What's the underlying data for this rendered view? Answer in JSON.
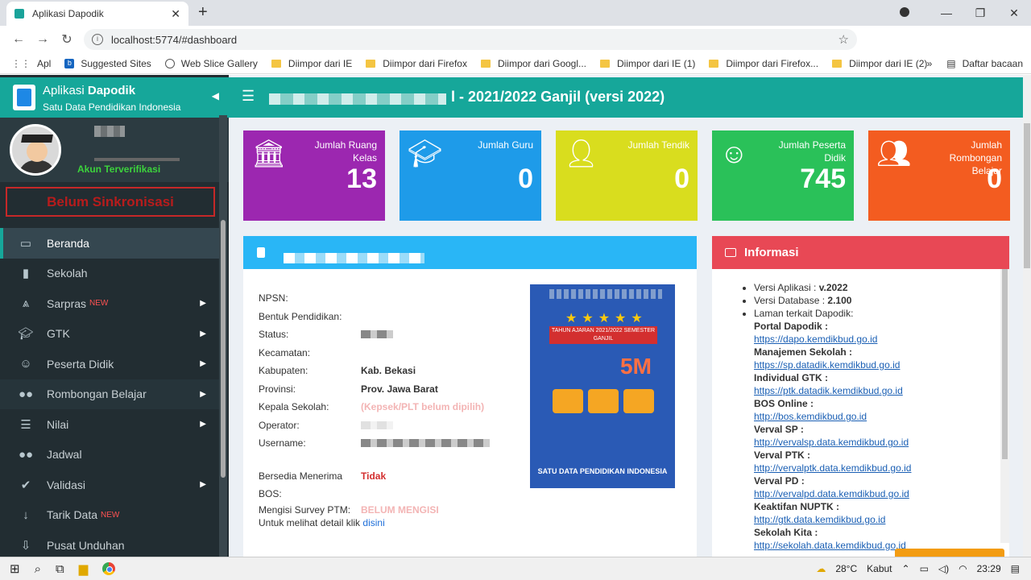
{
  "browser": {
    "tab_title": "Aplikasi Dapodik",
    "url": "localhost:5774/#dashboard",
    "bookmarks": [
      "Apl",
      "Suggested Sites",
      "Web Slice Gallery",
      "Diimpor dari IE",
      "Diimpor dari Firefox",
      "Diimpor dari Googl...",
      "Diimpor dari IE (1)",
      "Diimpor dari Firefox...",
      "Diimpor dari IE (2)"
    ],
    "reading_list": "Daftar bacaan",
    "more": "»"
  },
  "sidebar": {
    "app_name_prefix": "Aplikasi",
    "app_name_bold": "Dapodik",
    "app_subtitle": "Satu Data Pendidikan Indonesia",
    "verified": "Akun Terverifikasi",
    "sync_status": "Belum Sinkronisasi",
    "new_badge": "NEW",
    "items": [
      {
        "label": "Beranda",
        "icon": "monitor-icon"
      },
      {
        "label": "Sekolah",
        "icon": "building-icon"
      },
      {
        "label": "Sarpras",
        "icon": "road-icon"
      },
      {
        "label": "GTK",
        "icon": "graduation-cap-icon"
      },
      {
        "label": "Peserta Didik",
        "icon": "smile-icon"
      },
      {
        "label": "Rombongan Belajar",
        "icon": "users-icon"
      },
      {
        "label": "Nilai",
        "icon": "list-icon"
      },
      {
        "label": "Jadwal",
        "icon": "users-icon"
      },
      {
        "label": "Validasi",
        "icon": "check-icon"
      },
      {
        "label": "Tarik Data",
        "icon": "arrow-down-icon"
      },
      {
        "label": "Pusat Unduhan",
        "icon": "download-icon"
      }
    ]
  },
  "header": {
    "title": "l - 2021/2022 Ganjil (versi 2022)"
  },
  "stats": [
    {
      "label": "Jumlah Ruang Kelas",
      "value": "13",
      "icon": "institution-icon",
      "color": "#9c27b0"
    },
    {
      "label": "Jumlah Guru",
      "value": "0",
      "icon": "graduation-cap-icon",
      "color": "#1e9be9"
    },
    {
      "label": "Jumlah Tendik",
      "value": "0",
      "icon": "user-icon",
      "color": "#d9dd1e"
    },
    {
      "label": "Jumlah Peserta Didik",
      "value": "745",
      "icon": "smile-icon",
      "color": "#2ac159"
    },
    {
      "label": "Jumlah Rombongan Belajar",
      "value": "0",
      "icon": "users-icon",
      "color": "#f35c20"
    }
  ],
  "school": {
    "npsn_label": "NPSN:",
    "bentuk_label": "Bentuk Pendidikan:",
    "status_label": "Status:",
    "kecamatan_label": "Kecamatan:",
    "kabupaten_label": "Kabupaten:",
    "kabupaten_value": "Kab. Bekasi",
    "provinsi_label": "Provinsi:",
    "provinsi_value": "Prov. Jawa Barat",
    "kepsek_label": "Kepala Sekolah:",
    "kepsek_value": "(Kepsek/PLT belum dipilih)",
    "operator_label": "Operator:",
    "username_label": "Username:",
    "bos_label": "Bersedia Menerima BOS:",
    "bos_value": "Tidak",
    "survey_label": "Mengisi Survey PTM:",
    "survey_value": "BELUM MENGISI",
    "detail_text": "Untuk melihat detail klik",
    "detail_link": "disini"
  },
  "poster": {
    "ribbon": "TAHUN AJARAN 2021/2022 SEMESTER GANJIL",
    "big": "5M",
    "footer": "SATU DATA PENDIDIKAN INDONESIA"
  },
  "info": {
    "title": "Informasi",
    "version_label": "Versi Aplikasi :",
    "version_value": "v.2022",
    "db_label": "Versi Database :",
    "db_value": "2.100",
    "related_label": "Laman terkait Dapodik:",
    "links": [
      {
        "name": "Portal Dapodik :",
        "url": "https://dapo.kemdikbud.go.id"
      },
      {
        "name": "Manajemen Sekolah :",
        "url": "https://sp.datadik.kemdikbud.go.id"
      },
      {
        "name": "Individual GTK :",
        "url": "https://ptk.datadik.kemdikbud.go.id"
      },
      {
        "name": "BOS Online :",
        "url": "http://bos.kemdikbud.go.id"
      },
      {
        "name": "Verval SP :",
        "url": "http://vervalsp.data.kemdikbud.go.id"
      },
      {
        "name": "Verval PTK :",
        "url": "http://vervalptk.data.kemdikbud.go.id"
      },
      {
        "name": "Verval PD :",
        "url": "http://vervalpd.data.kemdikbud.go.id"
      },
      {
        "name": "Keaktifan NUPTK :",
        "url": "http://gtk.data.kemdikbud.go.id"
      },
      {
        "name": "Sekolah Kita :",
        "url": "http://sekolah.data.kemdikbud.go.id"
      }
    ]
  },
  "taskbar": {
    "temp": "28°C",
    "weather": "Kabut",
    "time": "23:29"
  }
}
